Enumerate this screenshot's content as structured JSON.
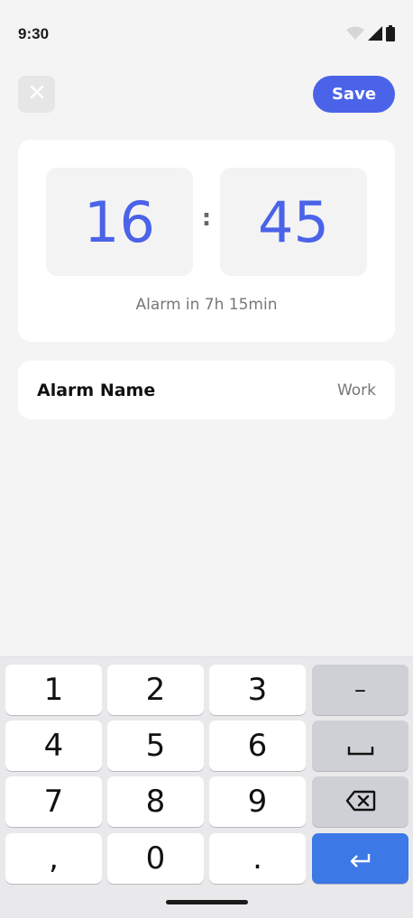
{
  "status_bar": {
    "time": "9:30",
    "icons": [
      "wifi-icon",
      "signal-icon",
      "battery-icon"
    ]
  },
  "toolbar": {
    "close_icon": "close-icon",
    "save_label": "Save"
  },
  "time_picker": {
    "hours": "16",
    "separator": ":",
    "minutes": "45",
    "alarm_in": "Alarm in 7h 15min"
  },
  "alarm_name": {
    "label": "Alarm Name",
    "value": "Work"
  },
  "keyboard": {
    "keys": [
      {
        "label": "1"
      },
      {
        "label": "2"
      },
      {
        "label": "3"
      },
      {
        "label": "–"
      },
      {
        "label": "4"
      },
      {
        "label": "5"
      },
      {
        "label": "6"
      },
      {
        "label": "space-icon"
      },
      {
        "label": "7"
      },
      {
        "label": "8"
      },
      {
        "label": "9"
      },
      {
        "label": "backspace-icon"
      },
      {
        "label": ","
      },
      {
        "label": "0"
      },
      {
        "label": "."
      },
      {
        "label": "enter-icon"
      }
    ]
  },
  "colors": {
    "accent": "#4a63e8",
    "enter_key": "#3c78e6",
    "background": "#f4f4f4"
  }
}
